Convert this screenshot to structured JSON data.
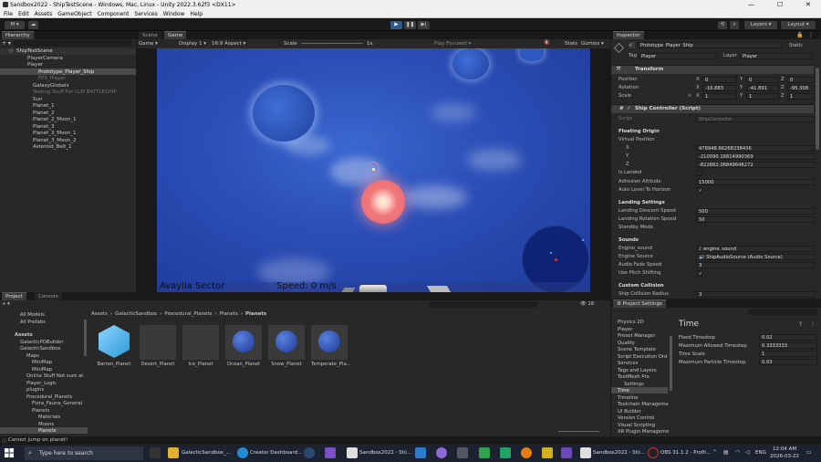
{
  "titlebar": {
    "title": "Sandbox2022 - ShipTestScene - Windows, Mac, Linux - Unity 2022.3.62f3 <DX11>",
    "min": "—",
    "max": "☐",
    "close": "✕"
  },
  "menu": [
    "File",
    "Edit",
    "Assets",
    "GameObject",
    "Component",
    "Services",
    "Window",
    "Help"
  ],
  "toolbar": {
    "account": "M",
    "cloud": "☁",
    "layers": "Layers",
    "layout": "Layout",
    "play": "▶",
    "pause": "❚❚",
    "step": "▶|"
  },
  "hierarchy": {
    "tab": "Hierarchy",
    "scene": "ShipTestScene",
    "items": [
      "PlayerCamera",
      "Player",
      "Prototype_Player_Ship",
      "FPS_Player",
      "GalaxyGlobals",
      "Testing Stuff For LLM BATTLESHIP",
      "Sun",
      "Planet_1",
      "Planet_2",
      "Planet_2_Moon_1",
      "Planet_3",
      "Planet_3_Moon_1",
      "Planet_3_Moon_2",
      "Asteroid_Belt_1"
    ]
  },
  "game": {
    "tabs": [
      "Scene",
      "Game"
    ],
    "display_mode": "Game",
    "display": "Display 1",
    "aspect": "16:9 Aspect",
    "scale_label": "Scale",
    "scale_value": "1x",
    "play_focused": "Play Focused",
    "stats": "Stats",
    "gizmos": "Gizmos",
    "sector": "Avaylia Sector",
    "speed": "Speed: 0 m/s"
  },
  "inspector": {
    "tab": "Inspector",
    "object": "Prototype_Player_Ship",
    "static": "Static",
    "tag_label": "Tag",
    "tag": "Player",
    "layer_label": "Layer",
    "layer": "Player",
    "transform": {
      "title": "Transform",
      "position": {
        "label": "Position",
        "x": "0",
        "y": "0",
        "z": "0"
      },
      "rotation": {
        "label": "Rotation",
        "x": "-16.883",
        "y": "-41.891",
        "z": "-95.308"
      },
      "scale": {
        "label": "Scale",
        "x": "1",
        "y": "1",
        "z": "1"
      }
    },
    "ship": {
      "title": "Ship Controller (Script)",
      "script_label": "Script",
      "script": "ShipController",
      "floating_origin": "Floating Origin",
      "virtual_position": "Virtual Position",
      "x_label": "X",
      "x": "478948.66268238436",
      "y_label": "Y",
      "y": "-210090.16814990369",
      "z_label": "Z",
      "z": "-822862.06849648272",
      "is_landed": "Is Landed",
      "adhesion_label": "Adhesion Altitude",
      "adhesion": "15000",
      "auto_level": "Auto Level To Horizon",
      "landing_settings": "Landing Settings",
      "descent_label": "Landing Descent Speed",
      "descent": "500",
      "rotation_label": "Landing Rotation Speed",
      "rotation": "50",
      "standby": "Standby Mode",
      "sounds": "Sounds",
      "engine_sound_label": "Engine_sound",
      "engine_sound": "engine_sound",
      "engine_source_label": "Engine Source",
      "engine_source": "ShipAudioSource (Audio Source)",
      "fade_label": "Audio Fade Speed",
      "fade": "3",
      "pitch_label": "Use Pitch Shifting",
      "collision": "Custom Collision",
      "collision_radius_label": "Ship Collision Radius",
      "collision_radius": "3"
    }
  },
  "project": {
    "tabs": [
      "Project",
      "Console"
    ],
    "favorites": [
      "All Models",
      "All Prefabs"
    ],
    "tree": [
      "Assets",
      "GalacticPOBuilder",
      "GalacticSandbox",
      "Maps",
      "MiniMap",
      "MiniMap",
      "Online Stuff Not sure at",
      "Player_Logic",
      "plugins",
      "Procedural_Planets",
      "Flora_Fauna_General",
      "Planets",
      "Materials",
      "Moons",
      "Planets"
    ],
    "breadcrumb": [
      "Assets",
      "GalacticSandbox",
      "Procedural_Planets",
      "Planets",
      "Planets"
    ],
    "files": [
      "Barren_Planet",
      "Desert_Planet",
      "Ice_Planet",
      "Ocean_Planet",
      "Snow_Planet",
      "Temperate_Pla..."
    ],
    "count": "18"
  },
  "project_settings": {
    "tab": "Project Settings",
    "categories": [
      "Physics 2D",
      "Player",
      "Preset Manager",
      "Quality",
      "Scene Template",
      "Script Execution Ord",
      "Services",
      "Tags and Layers",
      "TextMesh Pro",
      "Settings",
      "Time",
      "Timeline",
      "Toolchain Manageme",
      "UI Builder",
      "Version Control",
      "Visual Scripting",
      "XR Plugin Manageme"
    ],
    "section": "Time",
    "fields": [
      {
        "label": "Fixed Timestep",
        "value": "0.02"
      },
      {
        "label": "Maximum Allowed Timestep",
        "value": "0.3333333"
      },
      {
        "label": "Time Scale",
        "value": "1"
      },
      {
        "label": "Maximum Particle Timestep",
        "value": "0.03"
      }
    ]
  },
  "status": {
    "message": "Cannot jump on planet!"
  },
  "taskbar": {
    "search": "Type here to search",
    "apps": [
      "GalacticSandbox_...",
      "Creator Dashboard...",
      "Sandbox2022 - Shi...",
      "Sandbox2022 - Shi...",
      "OBS 31.1.2 - Profil..."
    ],
    "lang": "ENG",
    "time": "12:04 AM",
    "date": "2026-03-22"
  }
}
